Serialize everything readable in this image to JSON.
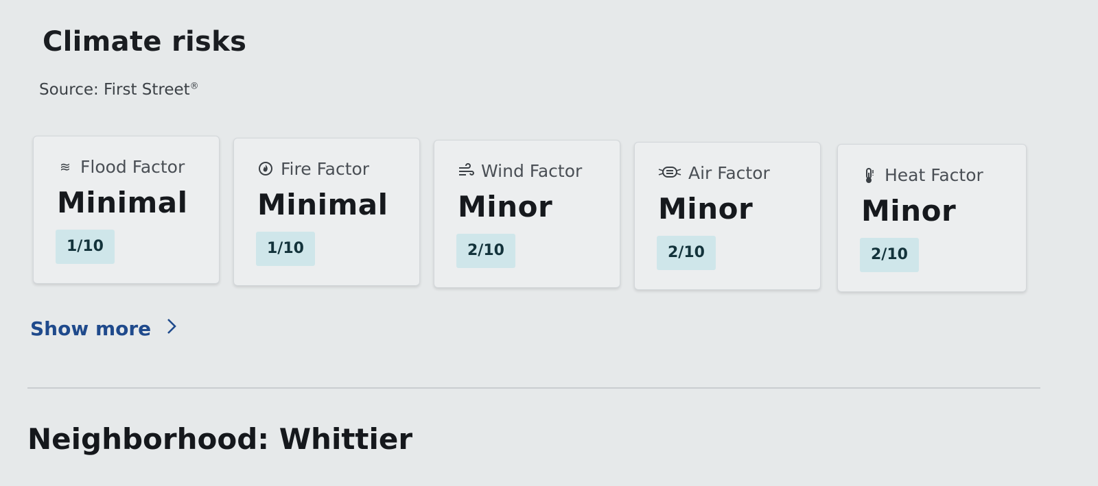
{
  "section": {
    "title": "Climate risks",
    "source_label": "Source: First Street",
    "source_mark": "®"
  },
  "cards": [
    {
      "icon": "flood-icon",
      "label": "Flood Factor",
      "level": "Minimal",
      "score": "1/10"
    },
    {
      "icon": "fire-icon",
      "label": "Fire Factor",
      "level": "Minimal",
      "score": "1/10"
    },
    {
      "icon": "wind-icon",
      "label": "Wind Factor",
      "level": "Minor",
      "score": "2/10"
    },
    {
      "icon": "air-icon",
      "label": "Air Factor",
      "level": "Minor",
      "score": "2/10"
    },
    {
      "icon": "heat-icon",
      "label": "Heat Factor",
      "level": "Minor",
      "score": "2/10"
    }
  ],
  "show_more": {
    "label": "Show more",
    "icon": "chevron-right-icon"
  },
  "neighborhood": {
    "title": "Neighborhood: Whittier"
  },
  "colors": {
    "background": "#e6e9ea",
    "score_badge": "#cfe6ea",
    "link": "#1f4a8c"
  }
}
